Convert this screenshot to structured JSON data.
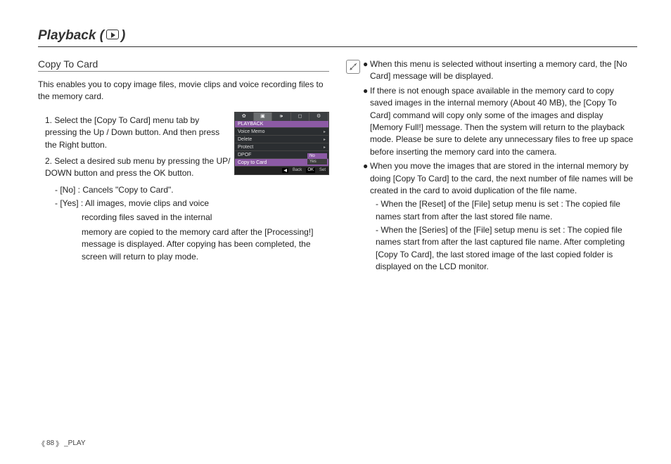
{
  "page": {
    "title_prefix": "Playback (",
    "title_suffix": " )",
    "footer_open": "《",
    "footer_page": "88",
    "footer_close": "》",
    "footer_section": "_PLAY"
  },
  "left": {
    "subheading": "Copy To Card",
    "intro": "This enables you to copy image files, movie clips and voice recording files to the memory card.",
    "step1": "1. Select the [Copy To Card] menu tab by pressing the Up / Down button. And then press the Right button.",
    "step2": "2. Select a desired sub menu by pressing the UP/ DOWN button and press the OK button.",
    "step2_no": "- [No]  : Cancels \"Copy to Card\".",
    "step2_yes_a": "- [Yes] : All images, movie clips and voice",
    "step2_yes_b": "recording files saved in the internal",
    "step2_yes_c": "memory are copied to the memory card after the [Processing!] message is displayed. After copying has been completed, the screen will return to play mode."
  },
  "cam": {
    "tab_icons": [
      "✿",
      "▣",
      "🕪",
      "◻",
      "⚙"
    ],
    "head": "PLAYBACK",
    "rows": [
      "Voice Memo",
      "Delete",
      "Protect",
      "DPOF",
      "Copy to Card"
    ],
    "sub_no": "No",
    "sub_yes": "Yes",
    "foot_back_btn": "◀",
    "foot_back": "Back",
    "foot_ok_btn": "OK",
    "foot_set": "Set"
  },
  "right": {
    "bullet1": "When this menu is selected without inserting a memory card, the [No Card] message will be displayed.",
    "bullet2": "If there is not enough space available in the memory card to copy saved images in the internal memory (About 40 MB), the [Copy To Card] command will copy only some of the images and display [Memory Full!] message. Then the system will return to the playback mode. Please be sure to delete any unnecessary files to free up space before inserting the memory card into the camera.",
    "bullet3": "When you move the images that are stored in the internal memory by doing [Copy To Card] to the card, the next number of file names will be created in the card to avoid duplication of the file name.",
    "bullet3_sub1": "- When the [Reset] of the [File] setup menu is set : The copied file names start from after the last stored file name.",
    "bullet3_sub2": "- When the [Series] of the [File] setup menu is set : The copied file names start from after the last captured file name. After completing [Copy To Card], the last stored image of the last copied folder is displayed on the LCD monitor."
  }
}
